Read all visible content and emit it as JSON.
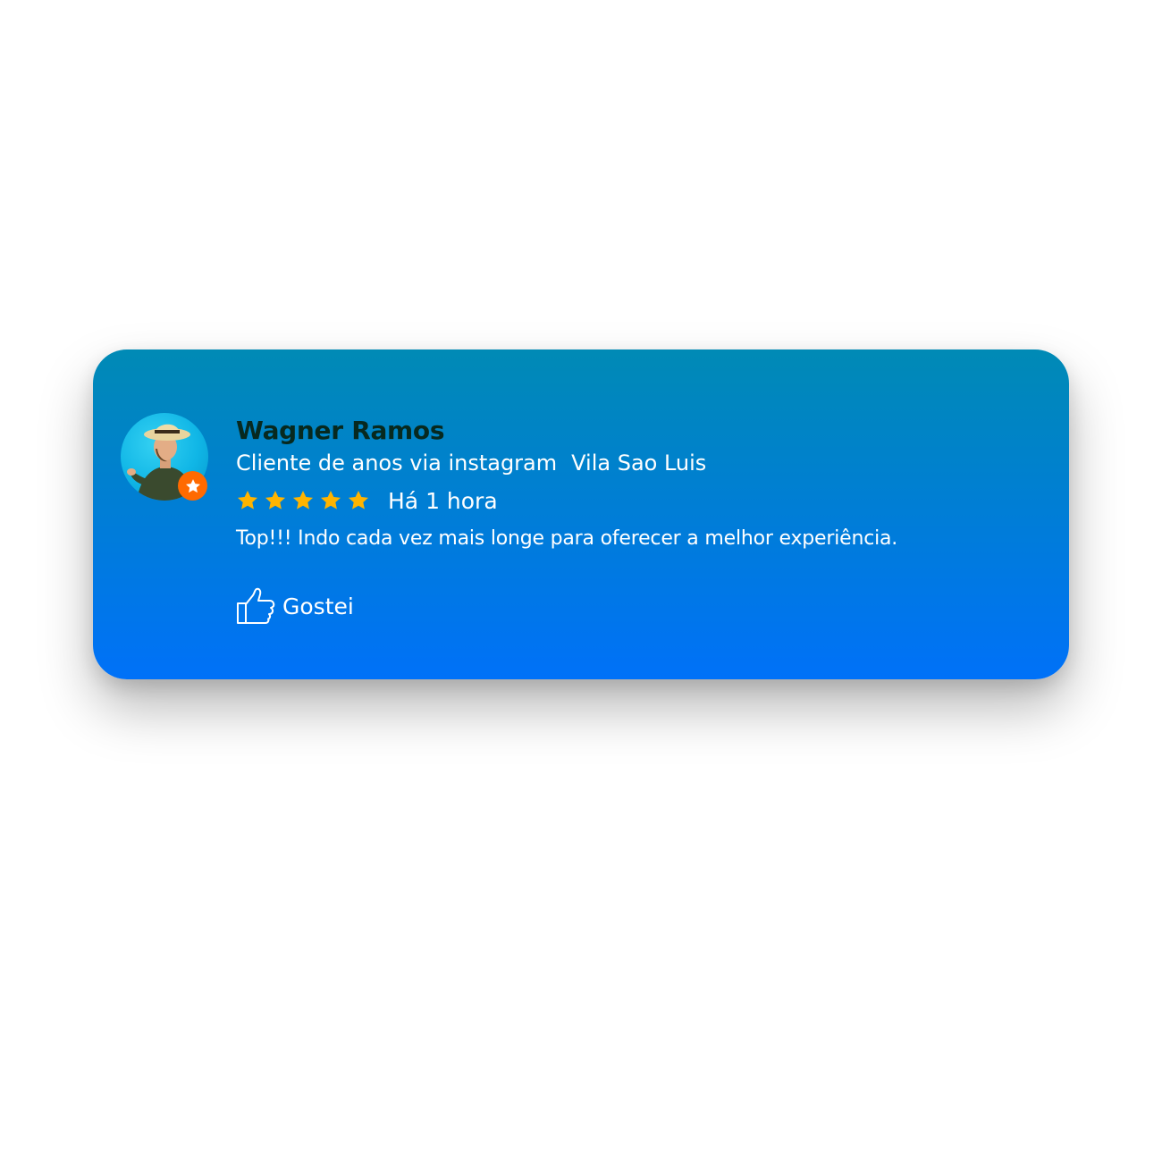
{
  "review": {
    "name": "Wagner Ramos",
    "subtitle_source": "Cliente de anos via instagram",
    "subtitle_location": "Vila Sao Luis",
    "rating": 5,
    "rating_max": 5,
    "time": "Há 1 hora",
    "comment": "Top!!! Indo cada vez mais longe para oferecer a melhor experiência.",
    "like_label": "Gostei"
  },
  "colors": {
    "card_top": "#008ab5",
    "card_bottom": "#0071f8",
    "name": "#07291f",
    "star": "#ffb400",
    "badge": "#ff6a00",
    "text": "#ffffff"
  },
  "icons": {
    "avatar": "user-photo",
    "badge": "star-icon",
    "rating": "star-icon",
    "like": "thumbs-up-icon"
  }
}
